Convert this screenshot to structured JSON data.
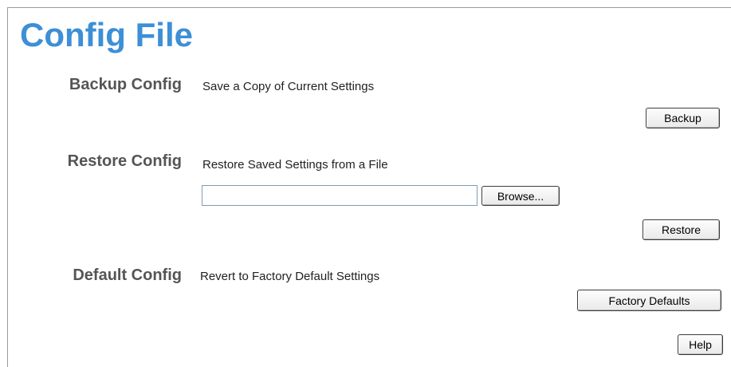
{
  "page": {
    "title": "Config File"
  },
  "backup": {
    "title": "Backup Config",
    "description": "Save a Copy of Current Settings",
    "button_label": "Backup"
  },
  "restore": {
    "title": "Restore Config",
    "description": "Restore Saved Settings from a File",
    "file_input_value": "",
    "browse_label": "Browse...",
    "button_label": "Restore"
  },
  "default": {
    "title": "Default Config",
    "description": "Revert to Factory Default Settings",
    "button_label": "Factory Defaults"
  },
  "help": {
    "button_label": "Help"
  },
  "colors": {
    "title_blue": "#3d8fd6",
    "section_gray": "#555555"
  }
}
